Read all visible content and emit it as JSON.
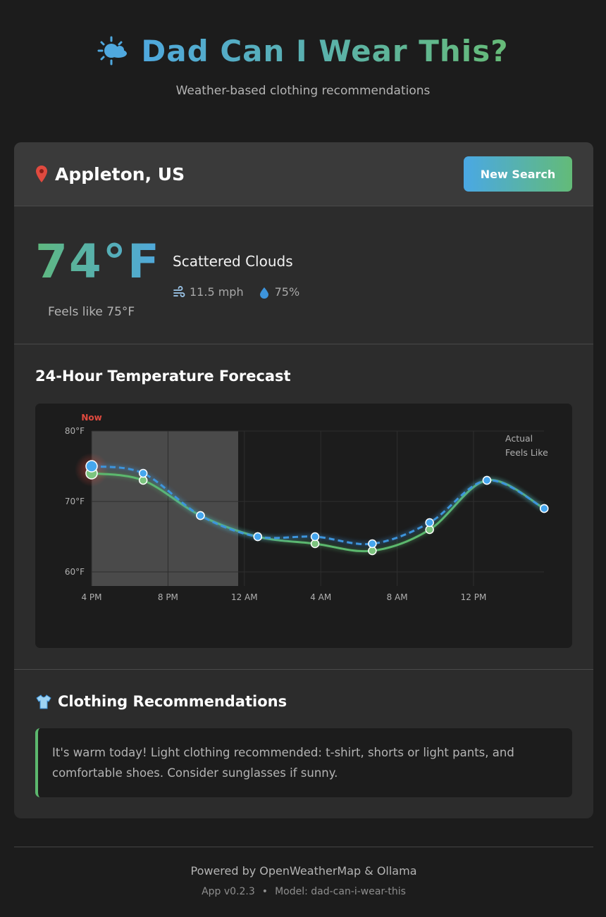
{
  "app": {
    "title": "Dad Can I Wear This?",
    "subtitle": "Weather-based clothing recommendations",
    "icon": "sun-behind-cloud-icon"
  },
  "location": {
    "name": "Appleton, US",
    "icon": "pin-icon",
    "new_search_label": "New Search"
  },
  "current": {
    "temperature": "74°F",
    "feels_like": "Feels like 75°F",
    "condition": "Scattered Clouds",
    "wind": "11.5 mph",
    "humidity": "75%"
  },
  "forecast": {
    "title": "24-Hour Temperature Forecast"
  },
  "chart_data": {
    "type": "line",
    "title": "24-Hour Temperature Forecast",
    "x_labels": [
      "4 PM",
      "8 PM",
      "12 AM",
      "4 AM",
      "8 AM",
      "12 PM"
    ],
    "x_hours": [
      0,
      2.7,
      5.7,
      8.7,
      11.7,
      14.7,
      17.7,
      20.7,
      23.7
    ],
    "ylim": [
      58,
      80
    ],
    "y_ticks": [
      60,
      70,
      80
    ],
    "y_tick_labels": [
      "60°F",
      "70°F",
      "80°F"
    ],
    "now_label": "Now",
    "series": [
      {
        "name": "Actual",
        "color": "#5cb86e",
        "values": [
          74,
          73,
          68,
          65,
          64,
          63,
          66,
          73,
          69
        ]
      },
      {
        "name": "Feels Like",
        "color": "#3d94dc",
        "values": [
          75,
          74,
          68,
          65,
          65,
          64,
          67,
          73,
          69
        ]
      }
    ],
    "legend_position": "top-right",
    "grid": true
  },
  "recommendations": {
    "title": "Clothing Recommendations",
    "text": "It's warm today! Light clothing recommended: t-shirt, shorts or light pants, and comfortable shoes. Consider sunglasses if sunny."
  },
  "footer": {
    "powered_by": "Powered by OpenWeatherMap & Ollama",
    "version": "App v0.2.3",
    "separator": "•",
    "model": "Model: dad-can-i-wear-this"
  }
}
